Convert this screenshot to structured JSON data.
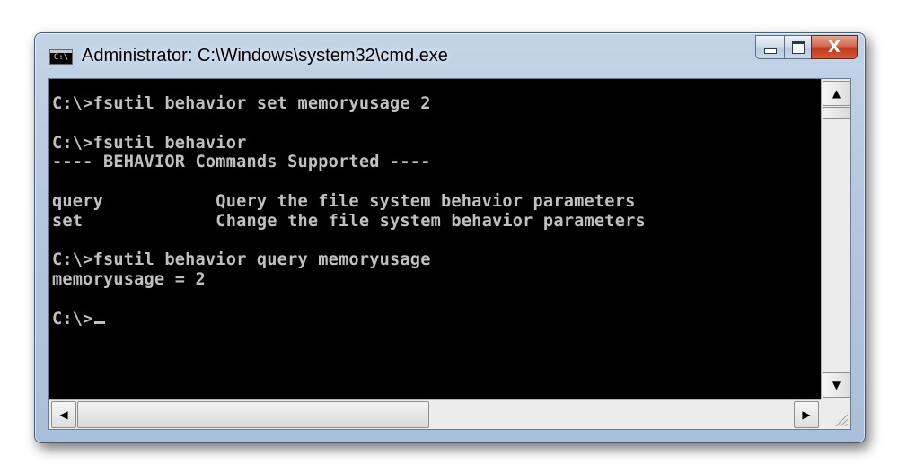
{
  "window": {
    "title": "Administrator: C:\\Windows\\system32\\cmd.exe",
    "icon_label": "C:\\",
    "icon_name": "cmd-icon",
    "buttons": {
      "minimize_icon": "minimize-icon",
      "maximize_icon": "maximize-icon",
      "close_icon": "close-icon",
      "close_glyph": "X"
    }
  },
  "console": {
    "lines": [
      "C:\\>fsutil behavior set memoryusage 2",
      "",
      "C:\\>fsutil behavior",
      "---- BEHAVIOR Commands Supported ----",
      "",
      "query           Query the file system behavior parameters",
      "set             Change the file system behavior parameters",
      "",
      "C:\\>fsutil behavior query memoryusage",
      "memoryusage = 2",
      "",
      "C:\\>"
    ],
    "text_color": "#c0c0c0",
    "background_color": "#000000"
  },
  "scrollbars": {
    "up_glyph": "▲",
    "down_glyph": "▼",
    "left_glyph": "◀",
    "right_glyph": "▶"
  }
}
